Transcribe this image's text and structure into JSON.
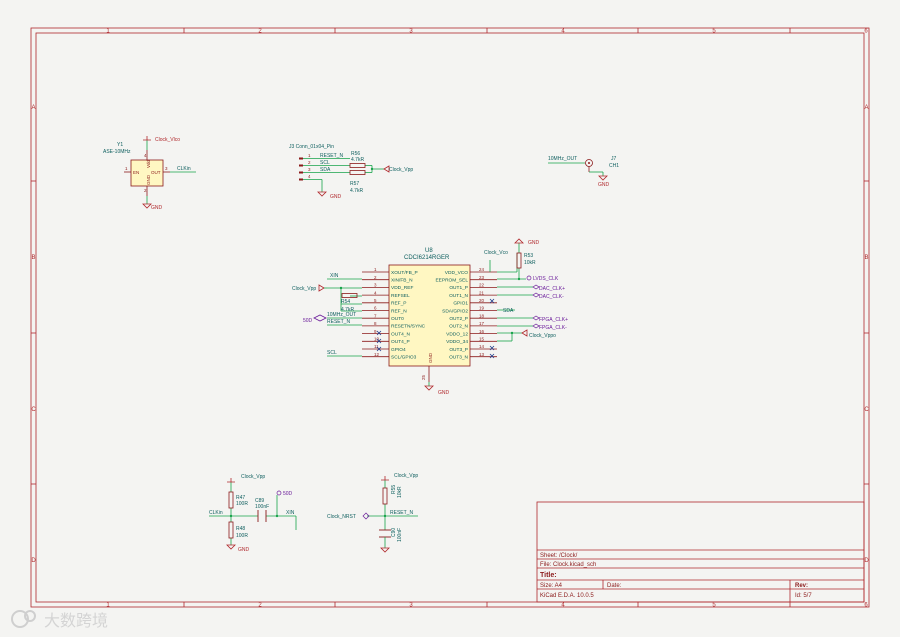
{
  "frame": {
    "columns": [
      "1",
      "2",
      "3",
      "4",
      "5",
      "6"
    ],
    "rows": [
      "A",
      "B",
      "C",
      "D"
    ]
  },
  "colors": {
    "border": "#b0282c",
    "wire": "#17a34a",
    "part": "#8b1a1a",
    "label": "#0d5e5e",
    "power": "#b0282c",
    "pin": "#8b1a1a",
    "hier": "#6a1b9a",
    "noconnect": "#1e3a8a",
    "sheet_bg": "#f4f4f2"
  },
  "y1": {
    "ref": "Y1",
    "value": "ASE-10MHz",
    "pin_en": "EN",
    "pin_out": "OUT",
    "pin_vdd": "Vdd",
    "pin_gnd": "GND",
    "pin_num_1": "1",
    "pin_num_2": "2",
    "pin_num_3": "3",
    "pin_num_4": "4",
    "power_top": "Clock_Vlco",
    "power_bottom": "GND",
    "net_out": "CLKin"
  },
  "j3": {
    "title": "J3 Conn_01x04_Pin",
    "pins": [
      "1",
      "2",
      "3",
      "4"
    ],
    "nets": [
      "RESET_N",
      "SCL",
      "SDA"
    ],
    "r56_ref": "R56",
    "r56_val": "4.7kR",
    "r57_ref": "R57",
    "r57_val": "4.7kR",
    "power": "Clock_Vpp",
    "gnd": "GND"
  },
  "j7": {
    "ref": "J7",
    "value": "CH1",
    "net": "10MHz_OUT",
    "gnd": "GND"
  },
  "u8": {
    "ref": "U8",
    "value": "CDCI6214RGER",
    "left_pins": [
      {
        "num": "1",
        "name": "XOUT/FB_P"
      },
      {
        "num": "2",
        "name": "XIN/FB_N"
      },
      {
        "num": "3",
        "name": "VDD_REF"
      },
      {
        "num": "4",
        "name": "REFSEL"
      },
      {
        "num": "5",
        "name": "REF_P"
      },
      {
        "num": "6",
        "name": "REF_N"
      },
      {
        "num": "7",
        "name": "OUT0"
      },
      {
        "num": "8",
        "name": "RESETN/SYNC"
      },
      {
        "num": "9",
        "name": "OUT4_N"
      },
      {
        "num": "10",
        "name": "OUT4_P"
      },
      {
        "num": "11",
        "name": "GPIO4"
      },
      {
        "num": "12",
        "name": "SCL/GPIO3"
      }
    ],
    "right_pins": [
      {
        "num": "24",
        "name": "VDD_VCO"
      },
      {
        "num": "23",
        "name": "EEPROM_SEL"
      },
      {
        "num": "22",
        "name": "OUT1_P"
      },
      {
        "num": "21",
        "name": "OUT1_N"
      },
      {
        "num": "20",
        "name": "GPIO1"
      },
      {
        "num": "19",
        "name": "SDA/GPIO2"
      },
      {
        "num": "18",
        "name": "OUT2_P"
      },
      {
        "num": "17",
        "name": "OUT2_N"
      },
      {
        "num": "16",
        "name": "VDDO_12"
      },
      {
        "num": "15",
        "name": "VDDO_34"
      },
      {
        "num": "14",
        "name": "OUT3_P"
      },
      {
        "num": "13",
        "name": "OUT3_N"
      }
    ],
    "gnd_pin_name": "GND",
    "gnd_pin_num": "25",
    "gnd": "GND",
    "vco_power": "Clock_Vco",
    "r53_ref": "R53",
    "r53_val": "10kR",
    "r54_ref": "R54",
    "r54_val": "4.7kR",
    "top_gnd": "GND",
    "net_xin": "XIN",
    "net_vpp": "Clock_Vpp",
    "net_50d": "50D",
    "net_10mhz": "10MHz_OUT",
    "net_reset": "RESET_N",
    "net_scl": "SCL",
    "net_sda": "SDA",
    "net_vppo": "Clock_Vppo",
    "hl_lvds": "LVDS_CLK",
    "hl_dac_p": "DAC_CLK+",
    "hl_dac_n": "DAC_CLK-",
    "hl_fpga_p": "FPGA_CLK+",
    "hl_fpga_n": "FPGA_CLK-"
  },
  "term": {
    "power": "Clock_Vpp",
    "r47_ref": "R47",
    "r47_val": "100R",
    "r48_ref": "R48",
    "r48_val": "100R",
    "c_ref": "C89",
    "c_val": "100nF",
    "net_50d": "50D",
    "net_clkin": "CLKin",
    "net_xin": "XIN",
    "gnd": "GND"
  },
  "rst": {
    "power": "Clock_Vpp",
    "r55_ref": "R55",
    "r55_val": "10kR",
    "c_ref": "C90",
    "c_val": "100nF",
    "net_in": "Clock_NRST",
    "net_reset": "RESET_N",
    "gnd": "GND"
  },
  "titleblock": {
    "sheet": "Sheet: /Clock/",
    "file": "File: Clock.kicad_sch",
    "title": "Title:",
    "size": "Size: A4",
    "date": "Date:",
    "rev": "Rev:",
    "tool": "KiCad E.D.A. 10.0.5",
    "id": "Id: 5/7"
  },
  "watermark": "大数跨境"
}
